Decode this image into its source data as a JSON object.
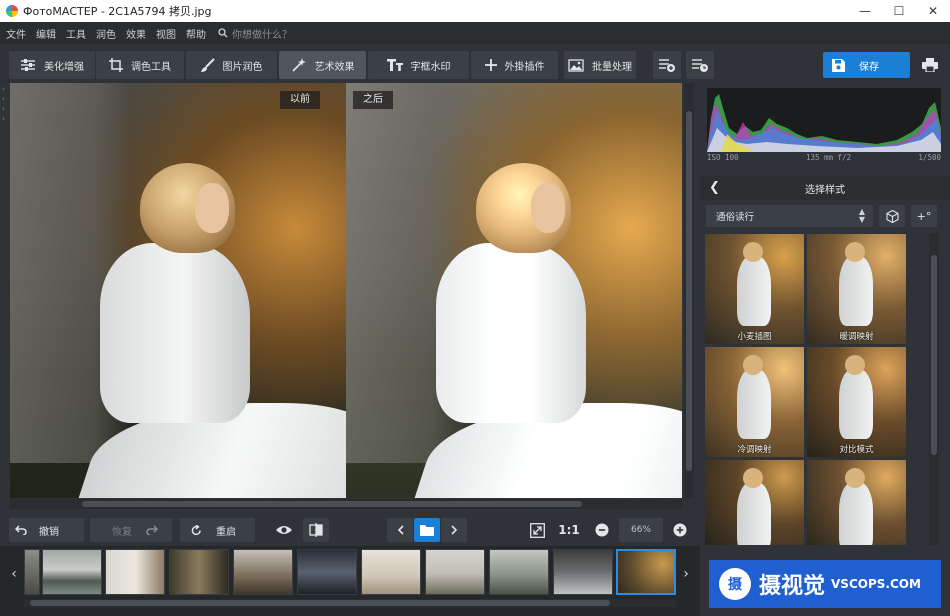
{
  "window": {
    "title": "ФотоМАСТЕР - 2C1A5794 拷贝.jpg",
    "controls": [
      "—",
      "☐",
      "✕"
    ]
  },
  "menu": {
    "items": [
      "文件",
      "编辑",
      "工具",
      "润色",
      "效果",
      "视图",
      "帮助"
    ],
    "search_placeholder": "你想做什么？"
  },
  "tabs": [
    {
      "label": "美化增强",
      "icon": "sliders-icon"
    },
    {
      "label": "调色工具",
      "icon": "crop-icon"
    },
    {
      "label": "图片润色",
      "icon": "brush-icon"
    },
    {
      "label": "艺术效果",
      "icon": "magic-wand-icon",
      "active": true
    },
    {
      "label": "字框水印",
      "icon": "text-icon"
    },
    {
      "label": "外掛插件",
      "icon": "plus-icon"
    },
    {
      "label": "批量处理",
      "icon": "images-icon"
    }
  ],
  "save": {
    "label": "保存"
  },
  "compare": {
    "before": "以前",
    "after": "之后"
  },
  "bottom": {
    "undo": "撤销",
    "redo": "恢复",
    "reset": "重启",
    "zoom_ratio": "1:1",
    "zoom_value": "66%"
  },
  "panel": {
    "histogram_meta": {
      "iso": "ISO 100",
      "lens": "135 mm f/2",
      "shutter": "1/500"
    },
    "title": "选择样式",
    "category": "通俗读行",
    "presets": [
      "小麦插图",
      "暖调映射",
      "冷调映射",
      "对比模式",
      "",
      ""
    ]
  },
  "watermark": {
    "logo": "摄",
    "cn": "摄视觉",
    "en": "VSCOPS.COM"
  },
  "colors": {
    "accent": "#1b7fd6",
    "selected_border": "#2f8be0",
    "background": "#2f3337"
  }
}
